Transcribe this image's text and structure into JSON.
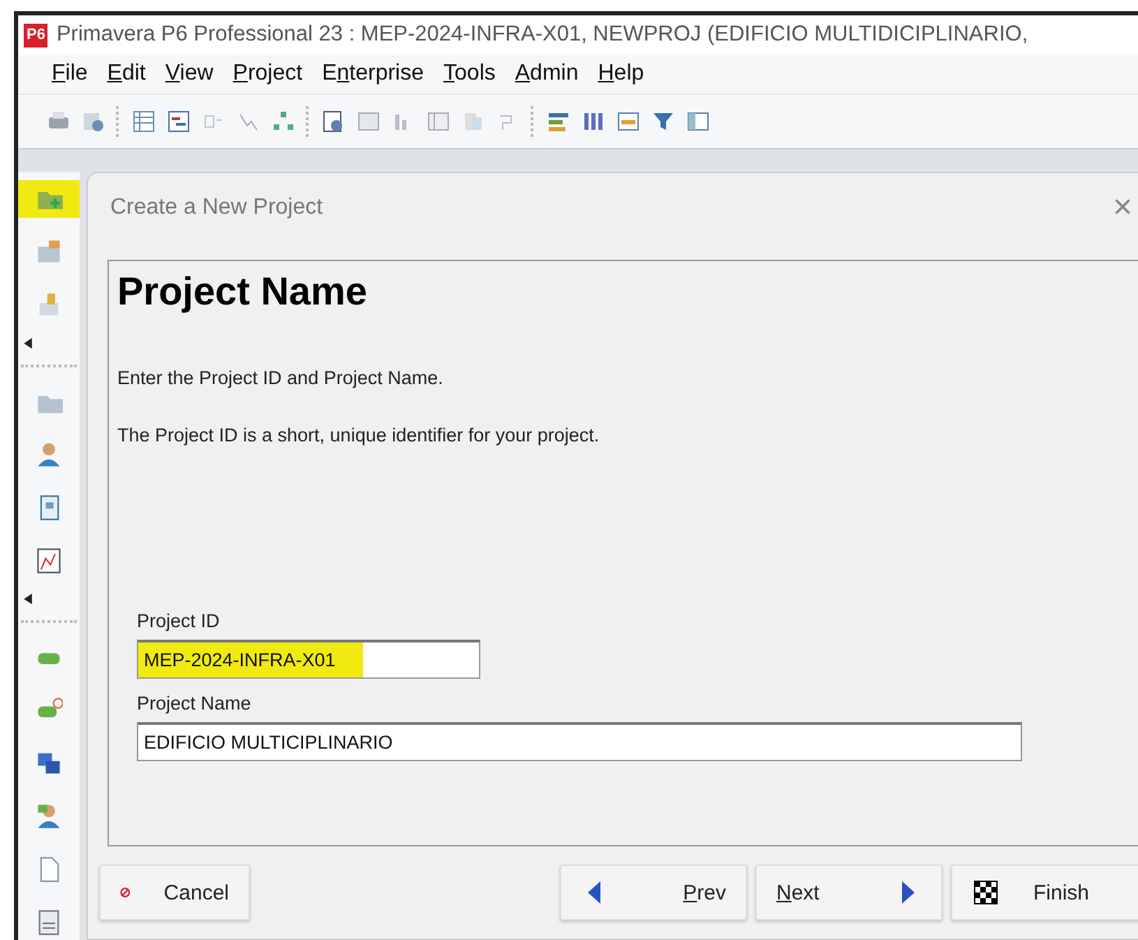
{
  "window": {
    "logo": "P6",
    "title": "Primavera P6 Professional 23 : MEP-2024-INFRA-X01, NEWPROJ (EDIFICIO MULTIDICIPLINARIO,"
  },
  "menu": [
    {
      "key": "F",
      "post": "ile"
    },
    {
      "key": "E",
      "post": "dit"
    },
    {
      "key": "V",
      "post": "iew"
    },
    {
      "key": "P",
      "post": "roject"
    },
    {
      "pre": "E",
      "key": "n",
      "post": "terprise"
    },
    {
      "key": "T",
      "post": "ools"
    },
    {
      "key": "A",
      "post": "dmin"
    },
    {
      "key": "H",
      "post": "elp"
    }
  ],
  "sidebar": {
    "items": [
      {
        "highlighted": true
      },
      {
        "highlighted": false
      },
      {
        "highlighted": false
      },
      {
        "highlighted": false
      },
      {
        "highlighted": false
      },
      {
        "highlighted": false
      },
      {
        "highlighted": false
      },
      {
        "highlighted": false
      },
      {
        "highlighted": false
      },
      {
        "highlighted": false
      },
      {
        "highlighted": false
      },
      {
        "highlighted": false
      },
      {
        "highlighted": false
      }
    ]
  },
  "dialog": {
    "title": "Create a New Project",
    "close": "×",
    "heading": "Project Name",
    "paragraphs": [
      "Enter the Project ID and Project Name.",
      "The Project ID is a short, unique identifier for your project."
    ],
    "fields": [
      {
        "label": "Project ID",
        "value": "MEP-2024-INFRA-X01",
        "highlighted": true,
        "kind": "short"
      },
      {
        "label": "Project Name",
        "value": "EDIFICIO MULTICIPLINARIO",
        "highlighted": false,
        "kind": "long"
      }
    ],
    "buttons": [
      {
        "kind": "cancel",
        "post": "Cancel"
      },
      {
        "kind": "prev",
        "key": "P",
        "post": "rev"
      },
      {
        "kind": "next",
        "key": "N",
        "post": "ext"
      },
      {
        "kind": "finish",
        "post": "Finish"
      }
    ]
  }
}
